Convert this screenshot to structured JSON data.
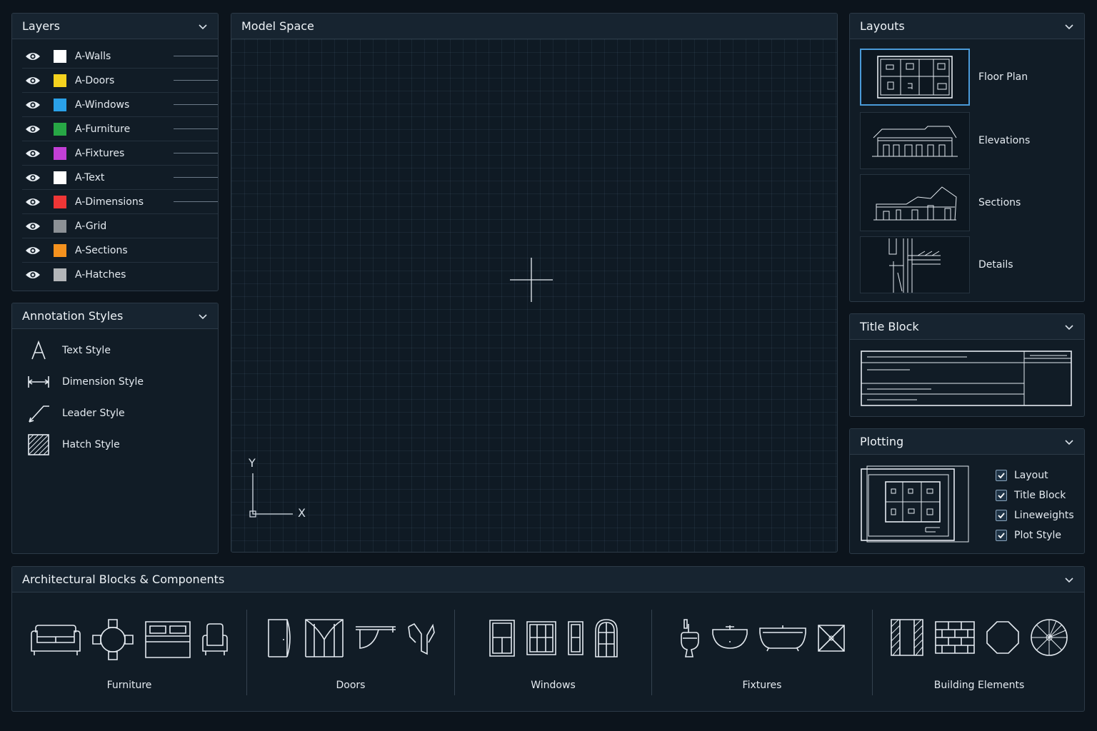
{
  "layers": {
    "title": "Layers",
    "items": [
      {
        "name": "A-Walls",
        "color": "#ffffff"
      },
      {
        "name": "A-Doors",
        "color": "#f5d21e"
      },
      {
        "name": "A-Windows",
        "color": "#2aa1e8"
      },
      {
        "name": "A-Furniture",
        "color": "#27a745"
      },
      {
        "name": "A-Fixtures",
        "color": "#c33fd6"
      },
      {
        "name": "A-Text",
        "color": "#ffffff"
      },
      {
        "name": "A-Dimensions",
        "color": "#ee3636"
      },
      {
        "name": "A-Grid",
        "color": "#8c9196"
      },
      {
        "name": "A-Sections",
        "color": "#f5921e"
      },
      {
        "name": "A-Hatches",
        "color": "#b3b6b9"
      }
    ]
  },
  "annotation": {
    "title": "Annotation Styles",
    "items": [
      "Text Style",
      "Dimension Style",
      "Leader Style",
      "Hatch Style"
    ]
  },
  "model": {
    "title": "Model Space",
    "y_label": "Y",
    "x_label": "X"
  },
  "layouts": {
    "title": "Layouts",
    "items": [
      "Floor Plan",
      "Elevations",
      "Sections",
      "Details"
    ]
  },
  "title_block": {
    "title": "Title Block"
  },
  "plotting": {
    "title": "Plotting",
    "options": [
      {
        "label": "Layout",
        "checked": true
      },
      {
        "label": "Title Block",
        "checked": true
      },
      {
        "label": "Lineweights",
        "checked": true
      },
      {
        "label": "Plot Style",
        "checked": true
      }
    ]
  },
  "blocks": {
    "title": "Architectural Blocks & Components",
    "groups": [
      "Furniture",
      "Doors",
      "Windows",
      "Fixtures",
      "Building Elements"
    ]
  },
  "colors": {
    "accent": "#4a9ad8",
    "background": "#0c141c",
    "panel": "#111c26"
  }
}
